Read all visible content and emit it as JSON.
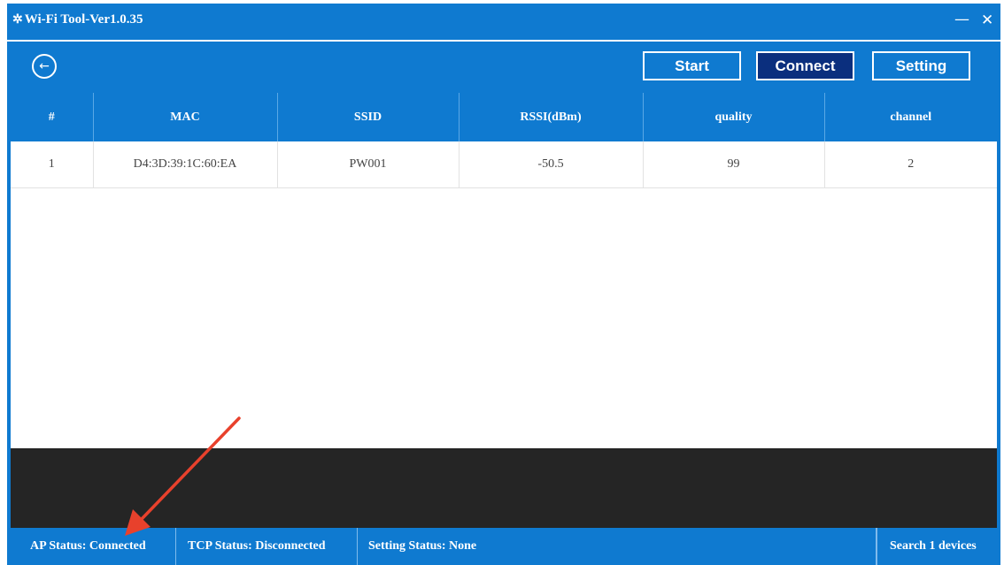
{
  "window": {
    "title": "Wi-Fi Tool-Ver1.0.35",
    "title_icon": "sparkle-icon",
    "minimize_glyph": "—",
    "close_glyph": "✕"
  },
  "toolbar": {
    "back_glyph": "←",
    "start_label": "Start",
    "connect_label": "Connect",
    "setting_label": "Setting"
  },
  "table": {
    "columns": [
      "#",
      "MAC",
      "SSID",
      "RSSI(dBm)",
      "quality",
      "channel"
    ],
    "rows": [
      {
        "index": "1",
        "mac": "D4:3D:39:1C:60:EA",
        "ssid": "PW001",
        "rssi": "-50.5",
        "quality": "99",
        "channel": "2"
      }
    ]
  },
  "status": {
    "ap": "AP Status: Connected",
    "tcp": "TCP Status: Disconnected",
    "setting": "Setting Status: None",
    "search": "Search 1 devices"
  },
  "colors": {
    "primary": "#0f7ad0",
    "active_button": "#0b2f7e",
    "console": "#252525",
    "annotation_arrow": "#e8412c"
  }
}
